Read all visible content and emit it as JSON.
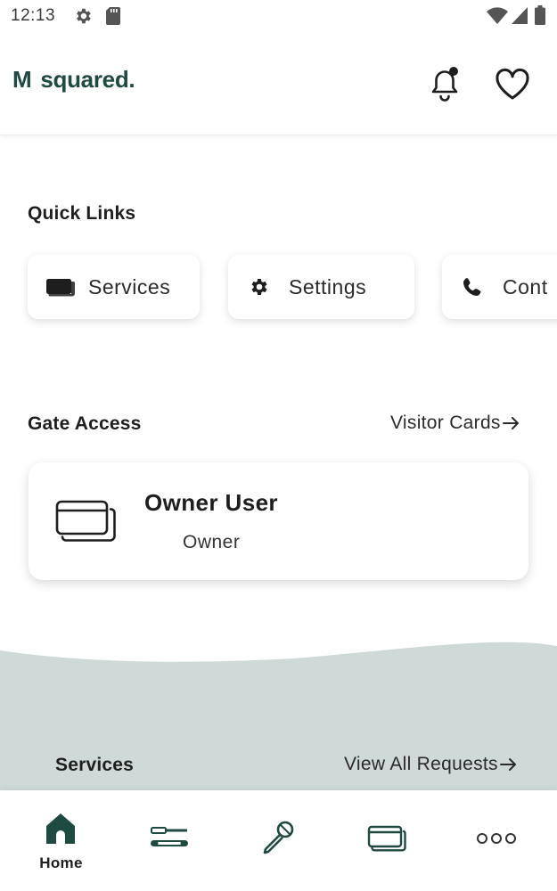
{
  "status_bar": {
    "time": "12:13",
    "icons": [
      "gear-icon",
      "sd-card-icon",
      "wifi-icon",
      "signal-icon",
      "battery-icon"
    ]
  },
  "header": {
    "logo_m": "M",
    "logo_word": "squared.",
    "icons": [
      "bell-icon",
      "heart-icon"
    ]
  },
  "quick_links": {
    "title": "Quick Links",
    "items": [
      {
        "label": "Services",
        "icon": "card-icon"
      },
      {
        "label": "Settings",
        "icon": "gear-icon"
      },
      {
        "label": "Cont",
        "icon": "phone-icon"
      }
    ]
  },
  "gate_access": {
    "title": "Gate Access",
    "link": "Visitor Cards",
    "card": {
      "name": "Owner User",
      "role": "Owner",
      "icon": "cards-icon"
    }
  },
  "services": {
    "title": "Services",
    "link": "View All Requests"
  },
  "bottom_nav": {
    "items": [
      {
        "label": "Home",
        "icon": "home-icon",
        "active": true
      },
      {
        "label": "",
        "icon": "tools-icon",
        "active": false
      },
      {
        "label": "",
        "icon": "microphone-icon",
        "active": false
      },
      {
        "label": "",
        "icon": "cards-icon",
        "active": false
      },
      {
        "label": "",
        "icon": "more-icon",
        "active": false
      }
    ]
  },
  "colors": {
    "brand": "#1f4a41",
    "wave": "#cfdad8",
    "text": "#1e1e1e",
    "surface": "#ffffff"
  }
}
